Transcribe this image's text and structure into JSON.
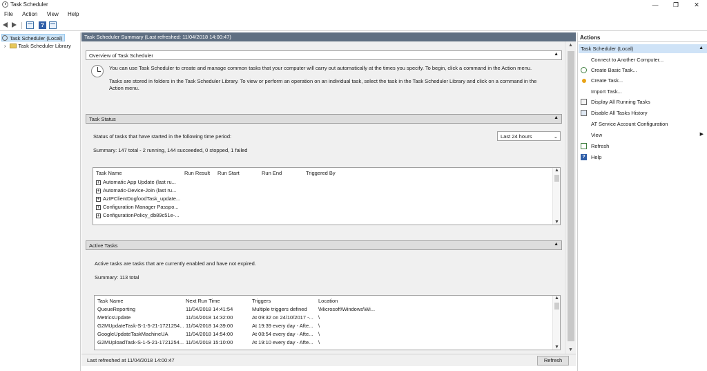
{
  "window": {
    "title": "Task Scheduler",
    "minimize": "—",
    "maximize": "❐",
    "close": "✕"
  },
  "menu": [
    "File",
    "Action",
    "View",
    "Help"
  ],
  "toolbar": {
    "help_glyph": "?"
  },
  "tree": {
    "root": "Task Scheduler (Local)",
    "child": "Task Scheduler Library",
    "expander": "›"
  },
  "center": {
    "header": "Task Scheduler Summary (Last refreshed: 11/04/2018 14:00:47)",
    "overview": {
      "title": "Overview of Task Scheduler",
      "para1": "You can use Task Scheduler to create and manage common tasks that your computer will carry out automatically at the times you specify. To begin, click a command in the Action menu.",
      "para2": "Tasks are stored in folders in the Task Scheduler Library. To view or perform an operation on an individual task, select the task in the Task Scheduler Library and click on a command in the Action menu."
    },
    "status": {
      "title": "Task Status",
      "period_label": "Status of tasks that have started in the following time period:",
      "period_value": "Last 24 hours",
      "summary": "Summary: 147 total - 2 running, 144 succeeded, 0 stopped, 1 failed",
      "columns": [
        "Task Name",
        "Run Result",
        "Run Start",
        "Run End",
        "Triggered By"
      ],
      "rows": [
        "Automatic App Update (last ru...",
        "Automatic-Device-Join (last ru...",
        "AzIPClientDogfoodTask_update...",
        "Configuration Manager Passpo...",
        "ConfigurationPolicy_db89c51e-..."
      ]
    },
    "active": {
      "title": "Active Tasks",
      "description": "Active tasks are tasks that are currently enabled and have not expired.",
      "summary": "Summary: 113 total",
      "columns": [
        "Task Name",
        "Next Run Time",
        "Triggers",
        "Location"
      ],
      "rows": [
        [
          "QueueReporting",
          "11/04/2018 14:41:54",
          "Multiple triggers defined",
          "\\Microsoft\\Windows\\Wi..."
        ],
        [
          "MetricsUpdate",
          "11/04/2018 14:32:00",
          "At 09:32 on 24/10/2017 -...",
          "\\"
        ],
        [
          "G2MUpdateTask-S-1-5-21-1721254...",
          "11/04/2018 14:39:00",
          "At 19:39 every day - Afte...",
          "\\"
        ],
        [
          "GoogleUpdateTaskMachineUA",
          "11/04/2018 14:54:00",
          "At 08:54 every day - Afte...",
          "\\"
        ],
        [
          "G2MUploadTask-S-1-5-21-1721254...",
          "11/04/2018 15:10:00",
          "At 19:10 every day - Afte...",
          "\\"
        ]
      ]
    },
    "footer": {
      "last_refreshed": "Last refreshed at 11/04/2018 14:00:47",
      "refresh_button": "Refresh"
    }
  },
  "actions": {
    "title": "Actions",
    "group": "Task Scheduler (Local)",
    "items": [
      "Connect to Another Computer...",
      "Create Basic Task...",
      "Create Task...",
      "Import Task...",
      "Display All Running Tasks",
      "Disable All Tasks History",
      "AT Service Account Configuration",
      "View",
      "Refresh",
      "Help"
    ],
    "help_glyph": "?"
  }
}
